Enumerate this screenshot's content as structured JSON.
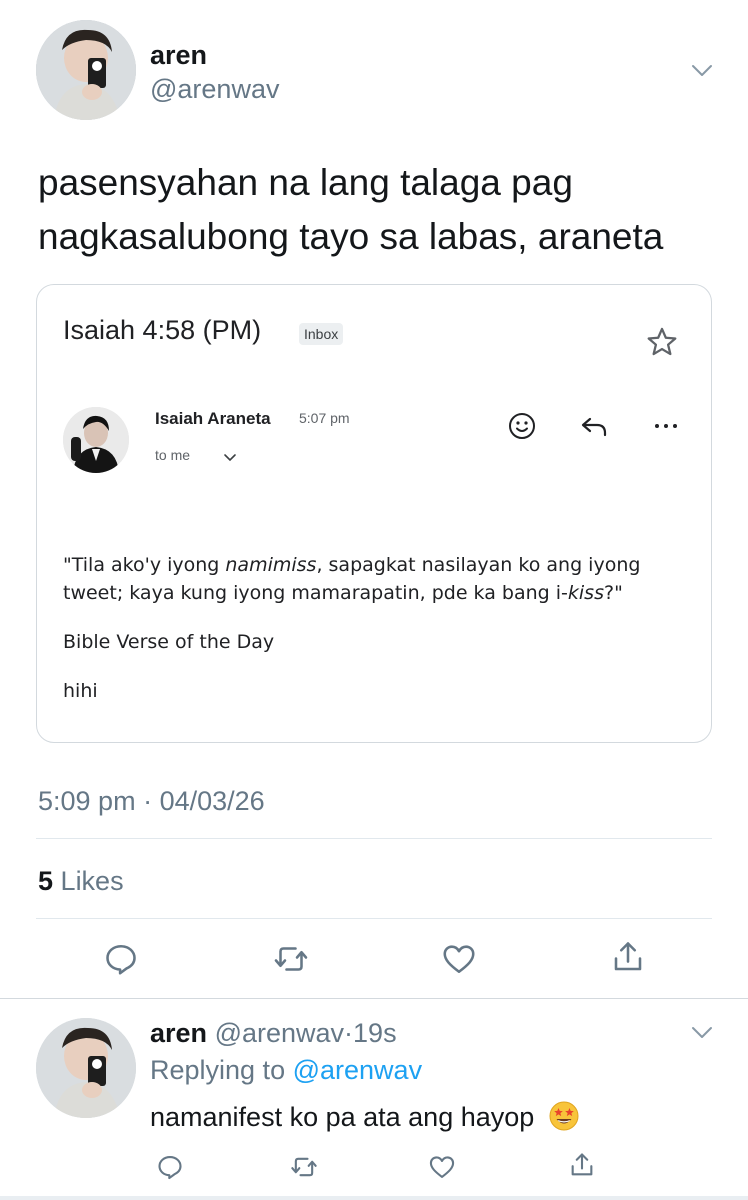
{
  "main_tweet": {
    "display_name": "aren",
    "handle": "@arenwav",
    "text_line1": "pasensyahan na lang talaga pag",
    "text_line2": "nagkasalubong tayo sa labas, araneta",
    "time": "5:09 pm",
    "separator": "·",
    "date": "04/03/26",
    "likes_count": "5",
    "likes_label": "Likes"
  },
  "email_card": {
    "subject": "Isaiah 4:58 (PM)",
    "label": "Inbox",
    "sender_name": "Isaiah Araneta",
    "sent_time": "5:07 pm",
    "recipient": "to me",
    "body_line1_a": "\"Tila ako'y iyong ",
    "body_line1_italic": "namimiss",
    "body_line1_b": ", sapagkat nasilayan ko ang iyong",
    "body_line2_a": "tweet; kaya kung iyong mamarapatin, pde ka bang i-",
    "body_line2_italic": "kiss",
    "body_line2_b": "?\"",
    "body_line3": "Bible Verse of the Day",
    "body_line4": "hihi"
  },
  "reply": {
    "display_name": "aren",
    "handle": "@arenwav",
    "separator": "·",
    "age": "19s",
    "replying_prefix": "Replying to",
    "replying_to": "@arenwav",
    "text": "namanifest ko pa ata ang hayop"
  },
  "icons": {
    "more": "chevron-down-icon",
    "reply": "reply-icon",
    "retweet": "retweet-icon",
    "like": "heart-icon",
    "share": "share-icon",
    "star": "star-icon",
    "emoji": "smiley-icon",
    "mail_reply": "mail-reply-icon",
    "overflow": "more-options-icon"
  },
  "colors": {
    "text_primary": "#14171a",
    "text_secondary": "#657786",
    "link": "#1da1f2",
    "divider": "#e1e8ed"
  }
}
